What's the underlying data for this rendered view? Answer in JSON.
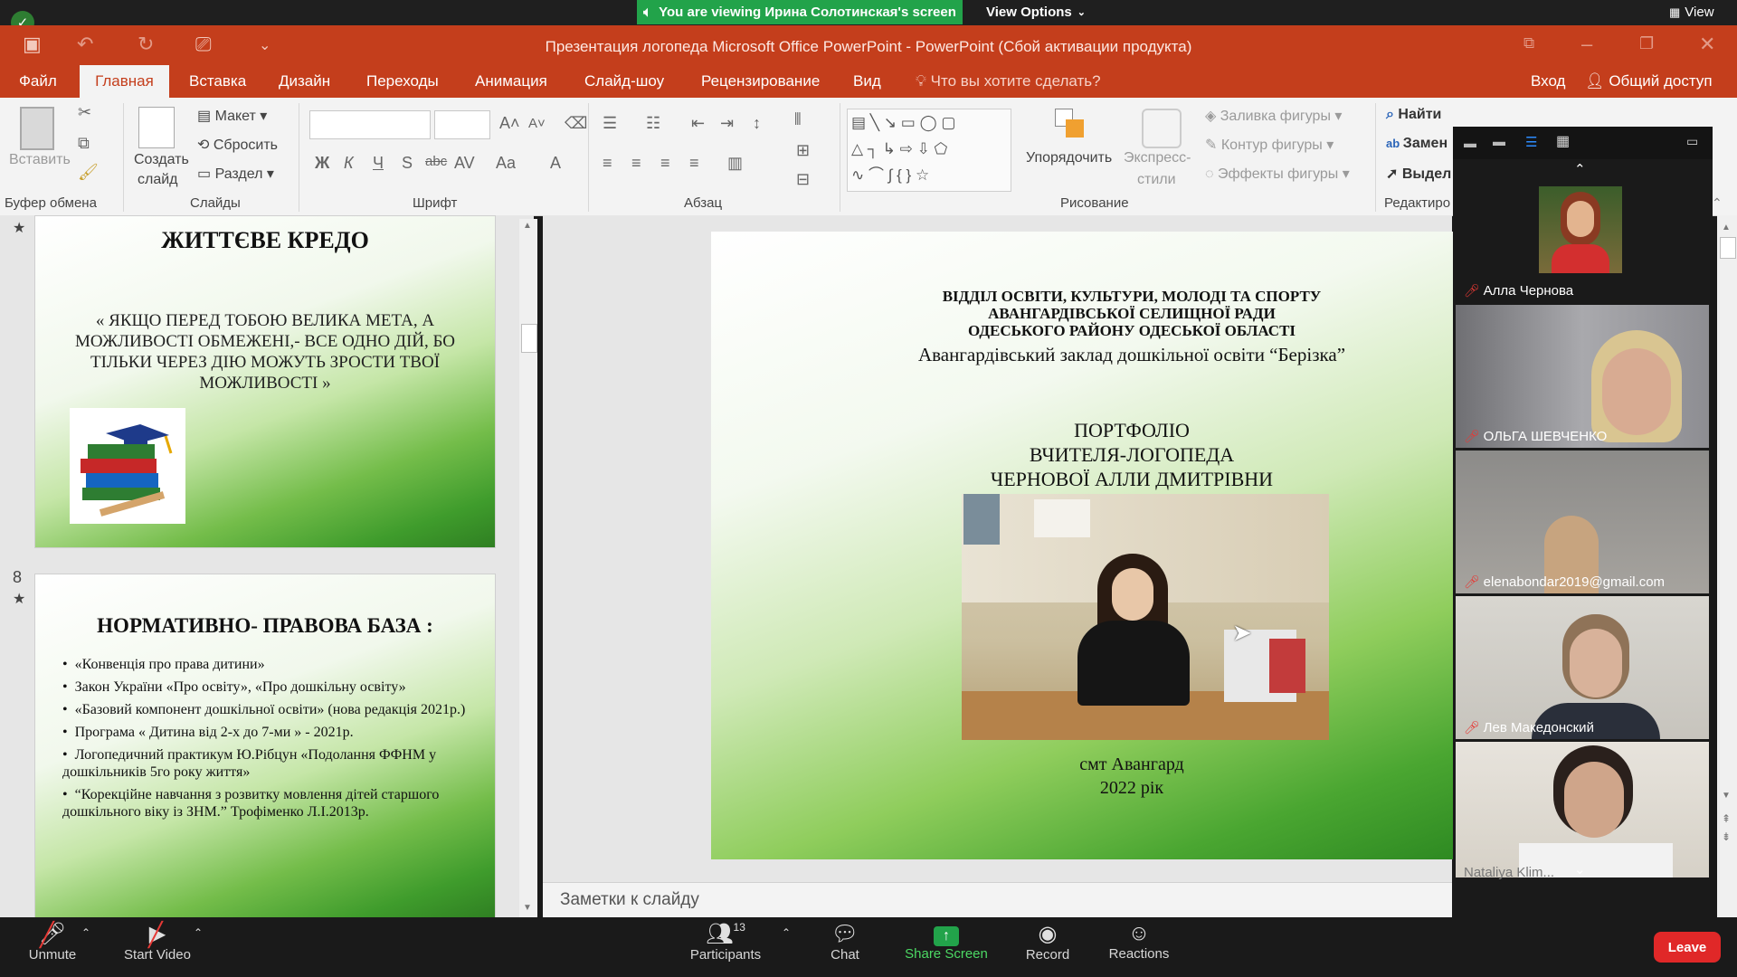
{
  "zoom": {
    "share_banner": "You are viewing Ирина Солотинская's screen",
    "view_options": "View Options",
    "view_label": "View",
    "bottom": {
      "unmute": "Unmute",
      "start_video": "Start Video",
      "participants": "Participants",
      "participant_count": "13",
      "chat": "Chat",
      "share_screen": "Share Screen",
      "record": "Record",
      "reactions": "Reactions",
      "leave": "Leave"
    },
    "participants": [
      {
        "name": "Алла Чернова"
      },
      {
        "name": "ОЛЬГА ШЕВЧЕНКО"
      },
      {
        "name": "elenabondar2019@gmail.com"
      },
      {
        "name": "Лев Македонский"
      },
      {
        "name": "Nataliya Klim..."
      }
    ]
  },
  "ppt": {
    "window_title": "Презентация логопеда  Microsoft Office PowerPoint - PowerPoint (Сбой активации продукта)",
    "tabs": [
      "Файл",
      "Главная",
      "Вставка",
      "Дизайн",
      "Переходы",
      "Анимация",
      "Слайд-шоу",
      "Рецензирование",
      "Вид"
    ],
    "tell_me": "Что вы хотите сделать?",
    "login": "Вход",
    "share": "Общий доступ",
    "ribbon": {
      "paste": "Вставить",
      "clipboard_group": "Буфер обмена",
      "new_slide_1": "Создать",
      "new_slide_2": "слайд",
      "layout": "Макет",
      "reset": "Сбросить",
      "section": "Раздел",
      "slides_group": "Слайды",
      "font_group": "Шрифт",
      "paragraph_group": "Абзац",
      "arrange": "Упорядочить",
      "quick_styles_1": "Экспресс-",
      "quick_styles_2": "стили",
      "shape_fill": "Заливка фигуры",
      "shape_outline": "Контур фигуры",
      "shape_effects": "Эффекты фигуры",
      "drawing_group": "Рисование",
      "find": "Найти",
      "replace": "Замен",
      "select": "Выдел",
      "editing_group": "Редактиро"
    },
    "notes_placeholder": "Заметки к слайду",
    "thumb7": {
      "title": "ЖИТТЄВЕ КРЕДО",
      "quote": "« ЯКЩО ПЕРЕД ТОБОЮ ВЕЛИКА МЕТА, А МОЖЛИВОСТІ ОБМЕЖЕНІ,- ВСЕ ОДНО ДІЙ, БО ТІЛЬКИ ЧЕРЕЗ ДІЮ МОЖУТЬ ЗРОСТИ ТВОЇ МОЖЛИВОСТІ  »"
    },
    "thumb8": {
      "number": "8",
      "title": "НОРМАТИВНО- ПРАВОВА БАЗА :",
      "bullets": [
        "«Конвенція про права дитини»",
        "Закон України «Про освіту», «Про дошкільну освіту»",
        "«Базовий компонент дошкільної освіти»      (нова редакція 2021р.)",
        "Програма « Дитина від 2-х до 7-ми » - 2021р.",
        "Логопедичний практикум Ю.Рібцун «Подолання ФФНМ у дошкільників 5го року життя»",
        "“Корекційне навчання з розвитку мовлення дітей старшого дошкільного віку  із ЗНМ.” Трофіменко Л.І.2013р."
      ]
    },
    "main_slide": {
      "header_1": "ВІДДІЛ ОСВІТИ, КУЛЬТУРИ, МОЛОДІ ТА СПОРТУ",
      "header_2": "АВАНГАРДІВСЬКОЇ СЕЛИЩНОЇ РАДИ",
      "header_3": "ОДЕСЬКОГО РАЙОНУ ОДЕСЬКОЇ ОБЛАСТІ",
      "institution": "Авангардівський заклад дошкільної освіти “Берізка”",
      "portfolio_1": "ПОРТФОЛІО",
      "portfolio_2": "ВЧИТЕЛЯ-ЛОГОПЕДА",
      "portfolio_3": "ЧЕРНОВОЇ АЛЛИ ДМИТРІВНИ",
      "place": "смт Авангард",
      "year": "2022 рік"
    }
  },
  "colors": {
    "ppt_accent": "#c43e1c",
    "zoom_green": "#22a34a",
    "leave_red": "#e02828"
  }
}
